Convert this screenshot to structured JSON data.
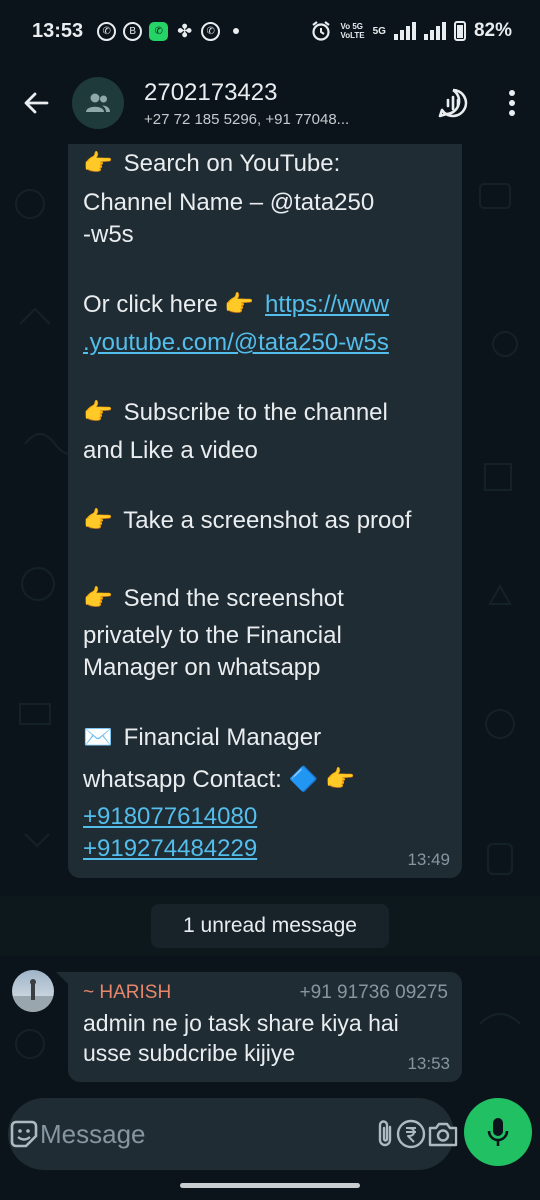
{
  "status_bar": {
    "time": "13:53",
    "network_label_top": "Vo 5G",
    "network_label_bottom": "VoLTE",
    "network_5g": "5G",
    "battery_percent": "82%",
    "notification_icons": [
      "whatsapp-icon",
      "whatsapp-business-icon",
      "phone-icon",
      "fan-icon",
      "whatsapp-icon"
    ]
  },
  "header": {
    "title": "2702173423",
    "subtitle": "+27 72 185 5296, +91 77048..."
  },
  "messages": {
    "outgoing": {
      "lines": {
        "l1": "Search on YouTube:",
        "l2": "Channel Name – @tata250",
        "l3": "-w5s",
        "l4": "Or click here",
        "link1": "https://www",
        "link2": ".youtube.com/@tata250-w5s",
        "l5": "Subscribe to the channel",
        "l6": "and Like a video",
        "l7": "Take a screenshot as proof",
        "l8": "Send the screenshot",
        "l9": "privately to the Financial",
        "l10": "Manager on whatsapp",
        "l11": "Financial Manager",
        "l12": "whatsapp  Contact:",
        "phone1": "+918077614080",
        "phone2": "+919274484229"
      },
      "time": "13:49"
    },
    "unread_label": "1 unread message",
    "incoming": {
      "sender": "~ HARISH",
      "phone": "+91 91736 09275",
      "line1": "admin ne jo task share kiya hai",
      "line2": "usse subdcribe kijiye",
      "time": "13:53"
    }
  },
  "input": {
    "placeholder": "Message"
  },
  "colors": {
    "background": "#0b141a",
    "bubble": "#202c33",
    "link": "#53bdeb",
    "accent_green": "#21c063",
    "sender_name": "#e7866b"
  }
}
